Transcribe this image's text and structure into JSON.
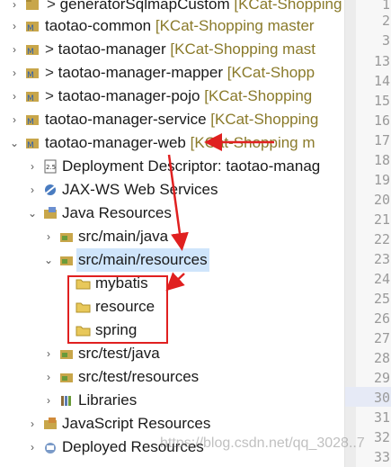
{
  "tree": {
    "items": [
      {
        "label": "generatorSqlmapCustom",
        "prefix": "> ",
        "decoration": "[KCat-Shopping",
        "icon": "project-icon"
      },
      {
        "label": "taotao-common",
        "prefix": "",
        "decoration": "[KCat-Shopping master",
        "icon": "maven-project-icon"
      },
      {
        "label": "taotao-manager",
        "prefix": "> ",
        "decoration": "[KCat-Shopping mast",
        "icon": "maven-project-icon"
      },
      {
        "label": "taotao-manager-mapper",
        "prefix": "> ",
        "decoration": "[KCat-Shopp",
        "icon": "maven-project-icon"
      },
      {
        "label": "taotao-manager-pojo",
        "prefix": "> ",
        "decoration": "[KCat-Shopping",
        "icon": "maven-project-icon"
      },
      {
        "label": "taotao-manager-service",
        "prefix": "",
        "decoration": "[KCat-Shopping",
        "icon": "maven-project-icon"
      },
      {
        "label": "taotao-manager-web",
        "prefix": "",
        "decoration": "[KCat-Shopping m",
        "icon": "maven-project-icon"
      },
      {
        "label": "Deployment Descriptor: taotao-manag",
        "prefix": "",
        "decoration": "",
        "icon": "deployment-descriptor-icon"
      },
      {
        "label": "JAX-WS Web Services",
        "prefix": "",
        "decoration": "",
        "icon": "web-services-icon"
      },
      {
        "label": "Java Resources",
        "prefix": "",
        "decoration": "",
        "icon": "java-resources-icon"
      },
      {
        "label": "src/main/java",
        "prefix": "",
        "decoration": "",
        "icon": "source-folder-icon"
      },
      {
        "label": "src/main/resources",
        "prefix": "",
        "decoration": "",
        "icon": "source-folder-icon"
      },
      {
        "label": "mybatis",
        "prefix": "",
        "decoration": "",
        "icon": "folder-icon"
      },
      {
        "label": "resource",
        "prefix": "",
        "decoration": "",
        "icon": "folder-icon"
      },
      {
        "label": "spring",
        "prefix": "",
        "decoration": "",
        "icon": "folder-icon"
      },
      {
        "label": "src/test/java",
        "prefix": "",
        "decoration": "",
        "icon": "source-folder-icon"
      },
      {
        "label": "src/test/resources",
        "prefix": "",
        "decoration": "",
        "icon": "source-folder-icon"
      },
      {
        "label": "Libraries",
        "prefix": "",
        "decoration": "",
        "icon": "libraries-icon"
      },
      {
        "label": "JavaScript Resources",
        "prefix": "",
        "decoration": "",
        "icon": "javascript-resources-icon"
      },
      {
        "label": "Deployed Resources",
        "prefix": "",
        "decoration": "",
        "icon": "deployed-resources-icon"
      }
    ]
  },
  "editor": {
    "line_numbers": [
      "1",
      "2",
      "3",
      "13",
      "14",
      "15",
      "16",
      "17",
      "18",
      "19",
      "20",
      "21",
      "22",
      "23",
      "24",
      "25",
      "26",
      "27",
      "28",
      "29",
      "30",
      "31",
      "32",
      "33"
    ]
  },
  "watermark": "https://blog.csdn.net/qq_3028..7",
  "colors": {
    "selection": "#cfe5fb",
    "annotation": "#e02020",
    "decoration": "#8a7a2a"
  }
}
